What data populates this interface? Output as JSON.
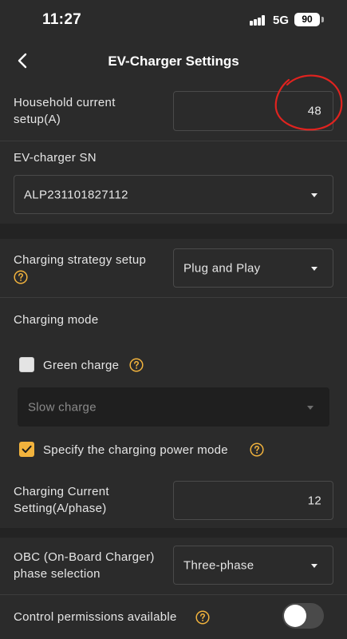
{
  "status_bar": {
    "time": "11:27",
    "network": "5G",
    "battery": "90"
  },
  "header": {
    "title": "EV-Charger Settings",
    "back_icon": "chevron-left-icon"
  },
  "household": {
    "label_line1": "Household current",
    "label_line2": "setup(A)",
    "value": "48"
  },
  "charger_sn": {
    "label": "EV-charger SN",
    "value": "ALP231101827112"
  },
  "strategy": {
    "label": "Charging strategy setup",
    "value": "Plug and Play"
  },
  "mode": {
    "label": "Charging mode",
    "green_charge_label": "Green charge",
    "green_charge_checked": false,
    "speed_placeholder": "Slow charge",
    "specify_power_label": "Specify the charging power mode",
    "specify_power_checked": true
  },
  "current_setting": {
    "label_line1": "Charging Current",
    "label_line2": "Setting(A/phase)",
    "value": "12"
  },
  "obc": {
    "label_line1": "OBC (On-Board Charger)",
    "label_line2": "phase selection",
    "value": "Three-phase"
  },
  "permissions": {
    "label": "Control permissions available",
    "enabled": false
  },
  "colors": {
    "background": "#2b2b2b",
    "accent": "#f2b33d",
    "annotation": "#e0231f"
  }
}
